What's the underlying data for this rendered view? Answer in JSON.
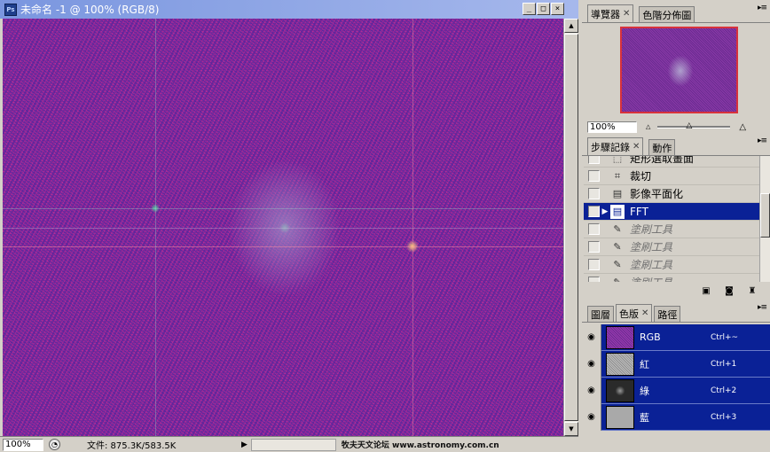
{
  "document": {
    "title": "未命名 -1 @ 100% (RGB/8)",
    "window_buttons": [
      "_",
      "□",
      "×"
    ]
  },
  "statusbar": {
    "zoom": "100%",
    "file_info": "文件: 875.3K/583.5K",
    "watermark": "牧夫天文论坛 www.astronomy.com.cn"
  },
  "navigator": {
    "tabs": [
      {
        "label": "導覽器",
        "active": true
      },
      {
        "label": "色階分佈圖",
        "active": false
      }
    ],
    "zoom": "100%"
  },
  "history": {
    "tabs": [
      {
        "label": "步驟記錄",
        "active": true
      },
      {
        "label": "動作",
        "active": false
      }
    ],
    "items": [
      {
        "label": "矩形選取畫面",
        "icon": "marquee-icon",
        "state": "normal"
      },
      {
        "label": "裁切",
        "icon": "crop-icon",
        "state": "normal"
      },
      {
        "label": "影像平面化",
        "icon": "flatten-icon",
        "state": "normal"
      },
      {
        "label": "FFT",
        "icon": "document-icon",
        "state": "selected"
      },
      {
        "label": "塗刷工具",
        "icon": "brush-icon",
        "state": "greyed"
      },
      {
        "label": "塗刷工具",
        "icon": "brush-icon",
        "state": "greyed"
      },
      {
        "label": "塗刷工具",
        "icon": "brush-icon",
        "state": "greyed"
      },
      {
        "label": "塗刷工具",
        "icon": "brush-icon",
        "state": "greyed"
      }
    ]
  },
  "channels": {
    "tabs": [
      {
        "label": "圖層",
        "active": false
      },
      {
        "label": "色版",
        "active": true
      },
      {
        "label": "路徑",
        "active": false
      }
    ],
    "items": [
      {
        "name": "RGB",
        "shortcut": "Ctrl+~"
      },
      {
        "name": "紅",
        "shortcut": "Ctrl+1"
      },
      {
        "name": "綠",
        "shortcut": "Ctrl+2"
      },
      {
        "name": "藍",
        "shortcut": "Ctrl+3"
      }
    ]
  },
  "colors": {
    "selection": "#0a2196",
    "navigator_frame": "#d8323c",
    "image_base": "#7a2a95"
  }
}
